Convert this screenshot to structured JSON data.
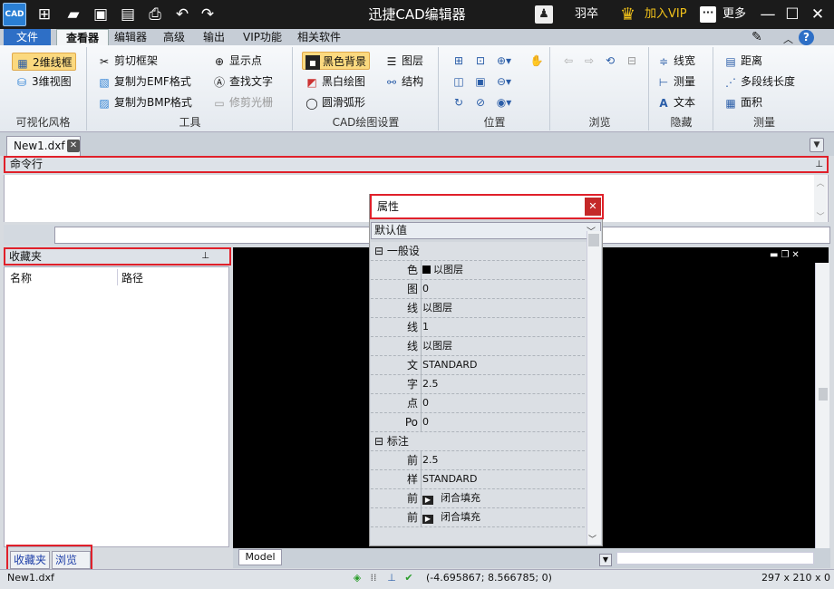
{
  "window": {
    "title": "迅捷CAD编辑器",
    "logo_text": "CAD",
    "user": "羽卒",
    "vip": "加入VIP",
    "more": "更多"
  },
  "menu": {
    "file": "文件",
    "viewer": "查看器",
    "editor": "编辑器",
    "advanced": "高级",
    "output": "输出",
    "vip": "VIP功能",
    "related": "相关软件"
  },
  "ribbon": {
    "visual_style": {
      "label": "可视化风格",
      "wireframe2d": "2维线框",
      "view3d": "3维视图"
    },
    "tools": {
      "label": "工具",
      "clip_frame": "剪切框架",
      "copy_emf": "复制为EMF格式",
      "copy_bmp": "复制为BMP格式",
      "show_points": "显示点",
      "find_text": "查找文字",
      "trim_raster": "修剪光栅"
    },
    "cad_settings": {
      "label": "CAD绘图设置",
      "black_bg": "黑色背景",
      "bw_draw": "黑白绘图",
      "smooth_arc": "圆滑弧形",
      "layers": "图层",
      "structure": "结构"
    },
    "position": {
      "label": "位置"
    },
    "browse": {
      "label": "浏览"
    },
    "hide": {
      "label": "隐藏",
      "line_width": "线宽",
      "measure": "测量",
      "text": "文本"
    },
    "measure": {
      "label": "测量",
      "distance": "距离",
      "polyline_length": "多段线长度",
      "area": "面积"
    }
  },
  "doc_tab": {
    "name": "New1.dxf"
  },
  "command_line": {
    "title": "命令行"
  },
  "favorites": {
    "title": "收藏夹",
    "col_name": "名称",
    "col_path": "路径",
    "tab_fav": "收藏夹",
    "tab_browser": "浏览器"
  },
  "properties": {
    "title": "属性",
    "selected": "默认值",
    "sections": [
      {
        "name": "一般设",
        "rows": [
          {
            "k": "色",
            "v": "以图层",
            "swatch": true
          },
          {
            "k": "图",
            "v": "0"
          },
          {
            "k": "线",
            "v": "以图层"
          },
          {
            "k": "线",
            "v": "1"
          },
          {
            "k": "线",
            "v": "以图层"
          },
          {
            "k": "文",
            "v": "STANDARD"
          },
          {
            "k": "字",
            "v": "2.5"
          },
          {
            "k": "点",
            "v": "0"
          },
          {
            "k": "Po",
            "v": "0"
          }
        ]
      },
      {
        "name": "标注",
        "rows": [
          {
            "k": "前",
            "v": "2.5"
          },
          {
            "k": "样",
            "v": "STANDARD"
          },
          {
            "k": "前",
            "v": "闭合填充",
            "arrow": true
          },
          {
            "k": "前",
            "v": "闭合填充",
            "arrow": true
          }
        ]
      }
    ]
  },
  "model_tab": "Model",
  "status": {
    "file": "New1.dxf",
    "coords": "(-4.695867; 8.566785; 0)",
    "size": "297 x 210 x 0"
  }
}
